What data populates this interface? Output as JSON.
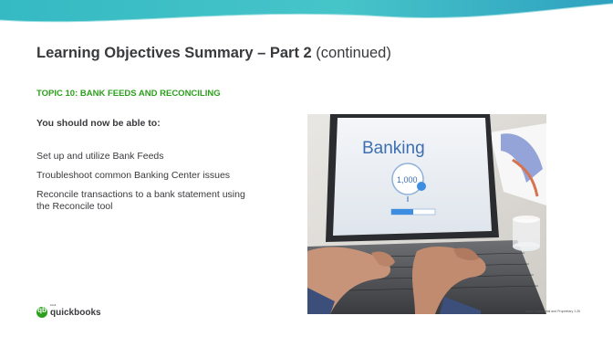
{
  "slide": {
    "title_bold": "Learning Objectives Summary – Part 2",
    "title_rest": " (continued)",
    "topic": "TOPIC 10: BANK FEEDS AND RECONCILING",
    "lead": "You should now be able to:",
    "bullets": [
      "Set up and utilize Bank Feeds",
      "Troubleshoot common Banking Center issues",
      "Reconcile transactions to a bank statement using the Reconcile tool"
    ],
    "footer": "Intuit Confidential and Proprietary   1.26"
  },
  "photo": {
    "screen_heading": "Banking",
    "screen_amount": "1,000"
  },
  "logo": {
    "small": "intuit",
    "word": "quickbooks",
    "mark": "qb"
  },
  "colors": {
    "brand_green": "#2ca01c",
    "band_teal": "#35b9c3",
    "text": "#393a3d"
  }
}
